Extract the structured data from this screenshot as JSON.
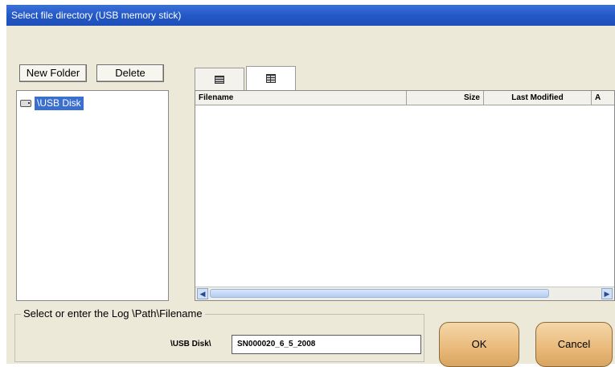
{
  "window": {
    "title": "Select file directory (USB memory stick)"
  },
  "toolbar": {
    "new_folder_label": "New Folder",
    "delete_label": "Delete"
  },
  "tree": {
    "items": [
      {
        "label": "\\USB Disk"
      }
    ]
  },
  "view_tabs": [
    {
      "icon": "list-view-icon"
    },
    {
      "icon": "details-view-icon"
    }
  ],
  "file_list": {
    "columns": [
      "Filename",
      "Size",
      "Last Modified",
      "A"
    ],
    "rows": []
  },
  "log_path": {
    "group_label": "Select or enter the Log \\Path\\Filename",
    "prefix_label": "\\USB Disk\\",
    "filename_value": "SN000020_6_5_2008"
  },
  "actions": {
    "ok_label": "OK",
    "cancel_label": "Cancel"
  },
  "colors": {
    "title_bar": "#2458c8",
    "selection": "#3a6fd0",
    "action_button": "#e9b97a",
    "dialog_bg": "#ece9d8"
  }
}
